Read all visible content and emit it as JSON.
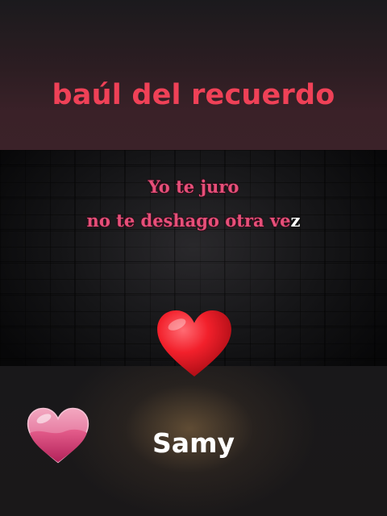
{
  "banner": {
    "title": "baúl del recuerdo",
    "color": "#ef4157"
  },
  "lyrics": {
    "line1": "Yo te juro",
    "line2_main": "no te deshago otra ve",
    "line2_highlight": "z",
    "color": "#e64f79",
    "highlight_color": "#ffffff"
  },
  "icons": {
    "big": "red-heart-icon",
    "small": "pink-heart-icon"
  },
  "footer": {
    "name": "Samy"
  }
}
